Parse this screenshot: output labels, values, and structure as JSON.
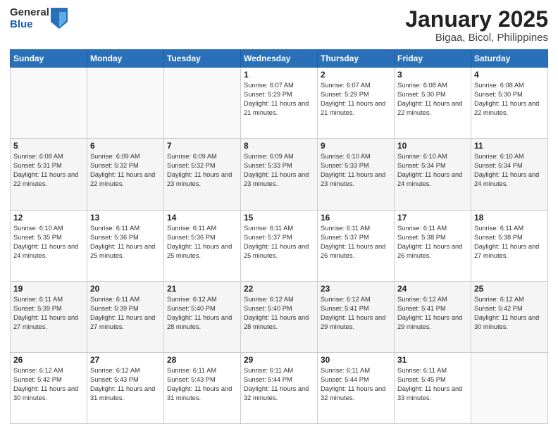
{
  "header": {
    "logo_general": "General",
    "logo_blue": "Blue",
    "title": "January 2025",
    "subtitle": "Bigaa, Bicol, Philippines"
  },
  "weekdays": [
    "Sunday",
    "Monday",
    "Tuesday",
    "Wednesday",
    "Thursday",
    "Friday",
    "Saturday"
  ],
  "weeks": [
    [
      {
        "day": "",
        "sunrise": "",
        "sunset": "",
        "daylight": ""
      },
      {
        "day": "",
        "sunrise": "",
        "sunset": "",
        "daylight": ""
      },
      {
        "day": "",
        "sunrise": "",
        "sunset": "",
        "daylight": ""
      },
      {
        "day": "1",
        "sunrise": "Sunrise: 6:07 AM",
        "sunset": "Sunset: 5:29 PM",
        "daylight": "Daylight: 11 hours and 21 minutes."
      },
      {
        "day": "2",
        "sunrise": "Sunrise: 6:07 AM",
        "sunset": "Sunset: 5:29 PM",
        "daylight": "Daylight: 11 hours and 21 minutes."
      },
      {
        "day": "3",
        "sunrise": "Sunrise: 6:08 AM",
        "sunset": "Sunset: 5:30 PM",
        "daylight": "Daylight: 11 hours and 22 minutes."
      },
      {
        "day": "4",
        "sunrise": "Sunrise: 6:08 AM",
        "sunset": "Sunset: 5:30 PM",
        "daylight": "Daylight: 11 hours and 22 minutes."
      }
    ],
    [
      {
        "day": "5",
        "sunrise": "Sunrise: 6:08 AM",
        "sunset": "Sunset: 5:31 PM",
        "daylight": "Daylight: 11 hours and 22 minutes."
      },
      {
        "day": "6",
        "sunrise": "Sunrise: 6:09 AM",
        "sunset": "Sunset: 5:32 PM",
        "daylight": "Daylight: 11 hours and 22 minutes."
      },
      {
        "day": "7",
        "sunrise": "Sunrise: 6:09 AM",
        "sunset": "Sunset: 5:32 PM",
        "daylight": "Daylight: 11 hours and 23 minutes."
      },
      {
        "day": "8",
        "sunrise": "Sunrise: 6:09 AM",
        "sunset": "Sunset: 5:33 PM",
        "daylight": "Daylight: 11 hours and 23 minutes."
      },
      {
        "day": "9",
        "sunrise": "Sunrise: 6:10 AM",
        "sunset": "Sunset: 5:33 PM",
        "daylight": "Daylight: 11 hours and 23 minutes."
      },
      {
        "day": "10",
        "sunrise": "Sunrise: 6:10 AM",
        "sunset": "Sunset: 5:34 PM",
        "daylight": "Daylight: 11 hours and 24 minutes."
      },
      {
        "day": "11",
        "sunrise": "Sunrise: 6:10 AM",
        "sunset": "Sunset: 5:34 PM",
        "daylight": "Daylight: 11 hours and 24 minutes."
      }
    ],
    [
      {
        "day": "12",
        "sunrise": "Sunrise: 6:10 AM",
        "sunset": "Sunset: 5:35 PM",
        "daylight": "Daylight: 11 hours and 24 minutes."
      },
      {
        "day": "13",
        "sunrise": "Sunrise: 6:11 AM",
        "sunset": "Sunset: 5:36 PM",
        "daylight": "Daylight: 11 hours and 25 minutes."
      },
      {
        "day": "14",
        "sunrise": "Sunrise: 6:11 AM",
        "sunset": "Sunset: 5:36 PM",
        "daylight": "Daylight: 11 hours and 25 minutes."
      },
      {
        "day": "15",
        "sunrise": "Sunrise: 6:11 AM",
        "sunset": "Sunset: 5:37 PM",
        "daylight": "Daylight: 11 hours and 25 minutes."
      },
      {
        "day": "16",
        "sunrise": "Sunrise: 6:11 AM",
        "sunset": "Sunset: 5:37 PM",
        "daylight": "Daylight: 11 hours and 26 minutes."
      },
      {
        "day": "17",
        "sunrise": "Sunrise: 6:11 AM",
        "sunset": "Sunset: 5:38 PM",
        "daylight": "Daylight: 11 hours and 26 minutes."
      },
      {
        "day": "18",
        "sunrise": "Sunrise: 6:11 AM",
        "sunset": "Sunset: 5:38 PM",
        "daylight": "Daylight: 11 hours and 27 minutes."
      }
    ],
    [
      {
        "day": "19",
        "sunrise": "Sunrise: 6:11 AM",
        "sunset": "Sunset: 5:39 PM",
        "daylight": "Daylight: 11 hours and 27 minutes."
      },
      {
        "day": "20",
        "sunrise": "Sunrise: 6:11 AM",
        "sunset": "Sunset: 5:39 PM",
        "daylight": "Daylight: 11 hours and 27 minutes."
      },
      {
        "day": "21",
        "sunrise": "Sunrise: 6:12 AM",
        "sunset": "Sunset: 5:40 PM",
        "daylight": "Daylight: 11 hours and 28 minutes."
      },
      {
        "day": "22",
        "sunrise": "Sunrise: 6:12 AM",
        "sunset": "Sunset: 5:40 PM",
        "daylight": "Daylight: 11 hours and 28 minutes."
      },
      {
        "day": "23",
        "sunrise": "Sunrise: 6:12 AM",
        "sunset": "Sunset: 5:41 PM",
        "daylight": "Daylight: 11 hours and 29 minutes."
      },
      {
        "day": "24",
        "sunrise": "Sunrise: 6:12 AM",
        "sunset": "Sunset: 5:41 PM",
        "daylight": "Daylight: 11 hours and 29 minutes."
      },
      {
        "day": "25",
        "sunrise": "Sunrise: 6:12 AM",
        "sunset": "Sunset: 5:42 PM",
        "daylight": "Daylight: 11 hours and 30 minutes."
      }
    ],
    [
      {
        "day": "26",
        "sunrise": "Sunrise: 6:12 AM",
        "sunset": "Sunset: 5:42 PM",
        "daylight": "Daylight: 11 hours and 30 minutes."
      },
      {
        "day": "27",
        "sunrise": "Sunrise: 6:12 AM",
        "sunset": "Sunset: 5:43 PM",
        "daylight": "Daylight: 11 hours and 31 minutes."
      },
      {
        "day": "28",
        "sunrise": "Sunrise: 6:11 AM",
        "sunset": "Sunset: 5:43 PM",
        "daylight": "Daylight: 11 hours and 31 minutes."
      },
      {
        "day": "29",
        "sunrise": "Sunrise: 6:11 AM",
        "sunset": "Sunset: 5:44 PM",
        "daylight": "Daylight: 11 hours and 32 minutes."
      },
      {
        "day": "30",
        "sunrise": "Sunrise: 6:11 AM",
        "sunset": "Sunset: 5:44 PM",
        "daylight": "Daylight: 11 hours and 32 minutes."
      },
      {
        "day": "31",
        "sunrise": "Sunrise: 6:11 AM",
        "sunset": "Sunset: 5:45 PM",
        "daylight": "Daylight: 11 hours and 33 minutes."
      },
      {
        "day": "",
        "sunrise": "",
        "sunset": "",
        "daylight": ""
      }
    ]
  ]
}
